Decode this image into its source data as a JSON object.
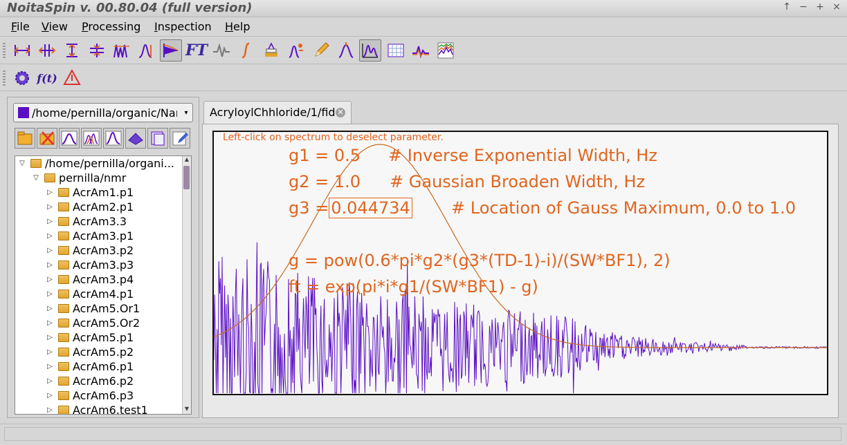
{
  "window": {
    "title": "NoitaSpin v. 00.80.04 (full version)",
    "controls": [
      "↑",
      "−",
      "+",
      "×"
    ]
  },
  "menu": {
    "items": [
      {
        "label": "File",
        "key": "F",
        "rest": "ile"
      },
      {
        "label": "View",
        "key": "V",
        "rest": "iew"
      },
      {
        "label": "Processing",
        "key": "P",
        "rest": "rocessing"
      },
      {
        "label": "Inspection",
        "key": "I",
        "rest": "nspection"
      },
      {
        "label": "Help",
        "key": "H",
        "rest": "elp"
      }
    ]
  },
  "toolbar1": {
    "icons": [
      "phase-left-icon",
      "phase-split-icon",
      "baseline-icon",
      "align-icon",
      "peaks-icon",
      "peak-pick-icon",
      "apodization-icon",
      "ft-icon",
      "phase-wave-icon",
      "integral-icon",
      "stack-icon",
      "multiplet-icon",
      "pencil-icon",
      "peak-marker-icon",
      "spectrum-view-icon",
      "grid-icon",
      "overlay-icon",
      "stacked-plot-icon"
    ],
    "ft_label": "FT",
    "active_index": 6,
    "active2_index": 14
  },
  "toolbar2": {
    "icons": [
      "gear-icon",
      "function-icon",
      "warning-triangle-icon"
    ],
    "fx_label": "f(t)"
  },
  "browser": {
    "path": "/home/pernilla/organic/Nar",
    "tree": [
      {
        "label": "/home/pernilla/organi...",
        "level": 0,
        "expanded": true
      },
      {
        "label": "pernilla/nmr",
        "level": 1,
        "expanded": true
      },
      {
        "label": "AcrAm1.p1",
        "level": 2
      },
      {
        "label": "AcrAm2.p1",
        "level": 2
      },
      {
        "label": "AcrAm3.3",
        "level": 2
      },
      {
        "label": "AcrAm3.p1",
        "level": 2
      },
      {
        "label": "AcrAm3.p2",
        "level": 2
      },
      {
        "label": "AcrAm3.p3",
        "level": 2
      },
      {
        "label": "AcrAm3.p4",
        "level": 2
      },
      {
        "label": "AcrAm4.p1",
        "level": 2
      },
      {
        "label": "AcrAm5.Or1",
        "level": 2
      },
      {
        "label": "AcrAm5.Or2",
        "level": 2
      },
      {
        "label": "AcrAm5.p1",
        "level": 2
      },
      {
        "label": "AcrAm5.p2",
        "level": 2
      },
      {
        "label": "AcrAm6.p1",
        "level": 2
      },
      {
        "label": "AcrAm6.p2",
        "level": 2
      },
      {
        "label": "AcrAm6.p3",
        "level": 2
      },
      {
        "label": "AcrAm6.test1",
        "level": 2
      }
    ]
  },
  "editor": {
    "tab_label": "AcryloylChhloride/1/fid",
    "hint": "Left-click on spectrum to deselect parameter.",
    "g1_line": "g1 = 0.5",
    "g1_comment": "# Inverse Exponential Width, Hz",
    "g2_line": "g2 = 1.0",
    "g2_comment": "# Gaussian Broaden Width, Hz",
    "g3_prefix": "g3 =",
    "g3_value": "0.044734",
    "g3_comment": "# Location of Gauss Maximum, 0.0 to 1.0",
    "formula_g": "g  = pow(0.6*pi*g2*(g3*(TD-1)-i)/(SW*BF1), 2)",
    "formula_ft": "ft = exp(pi*i*g1/(SW*BF1) - g)"
  },
  "colors": {
    "accent_text": "#e0651f",
    "fid_trace": "#5a0ec4",
    "window_curve": "#c86a1e"
  }
}
